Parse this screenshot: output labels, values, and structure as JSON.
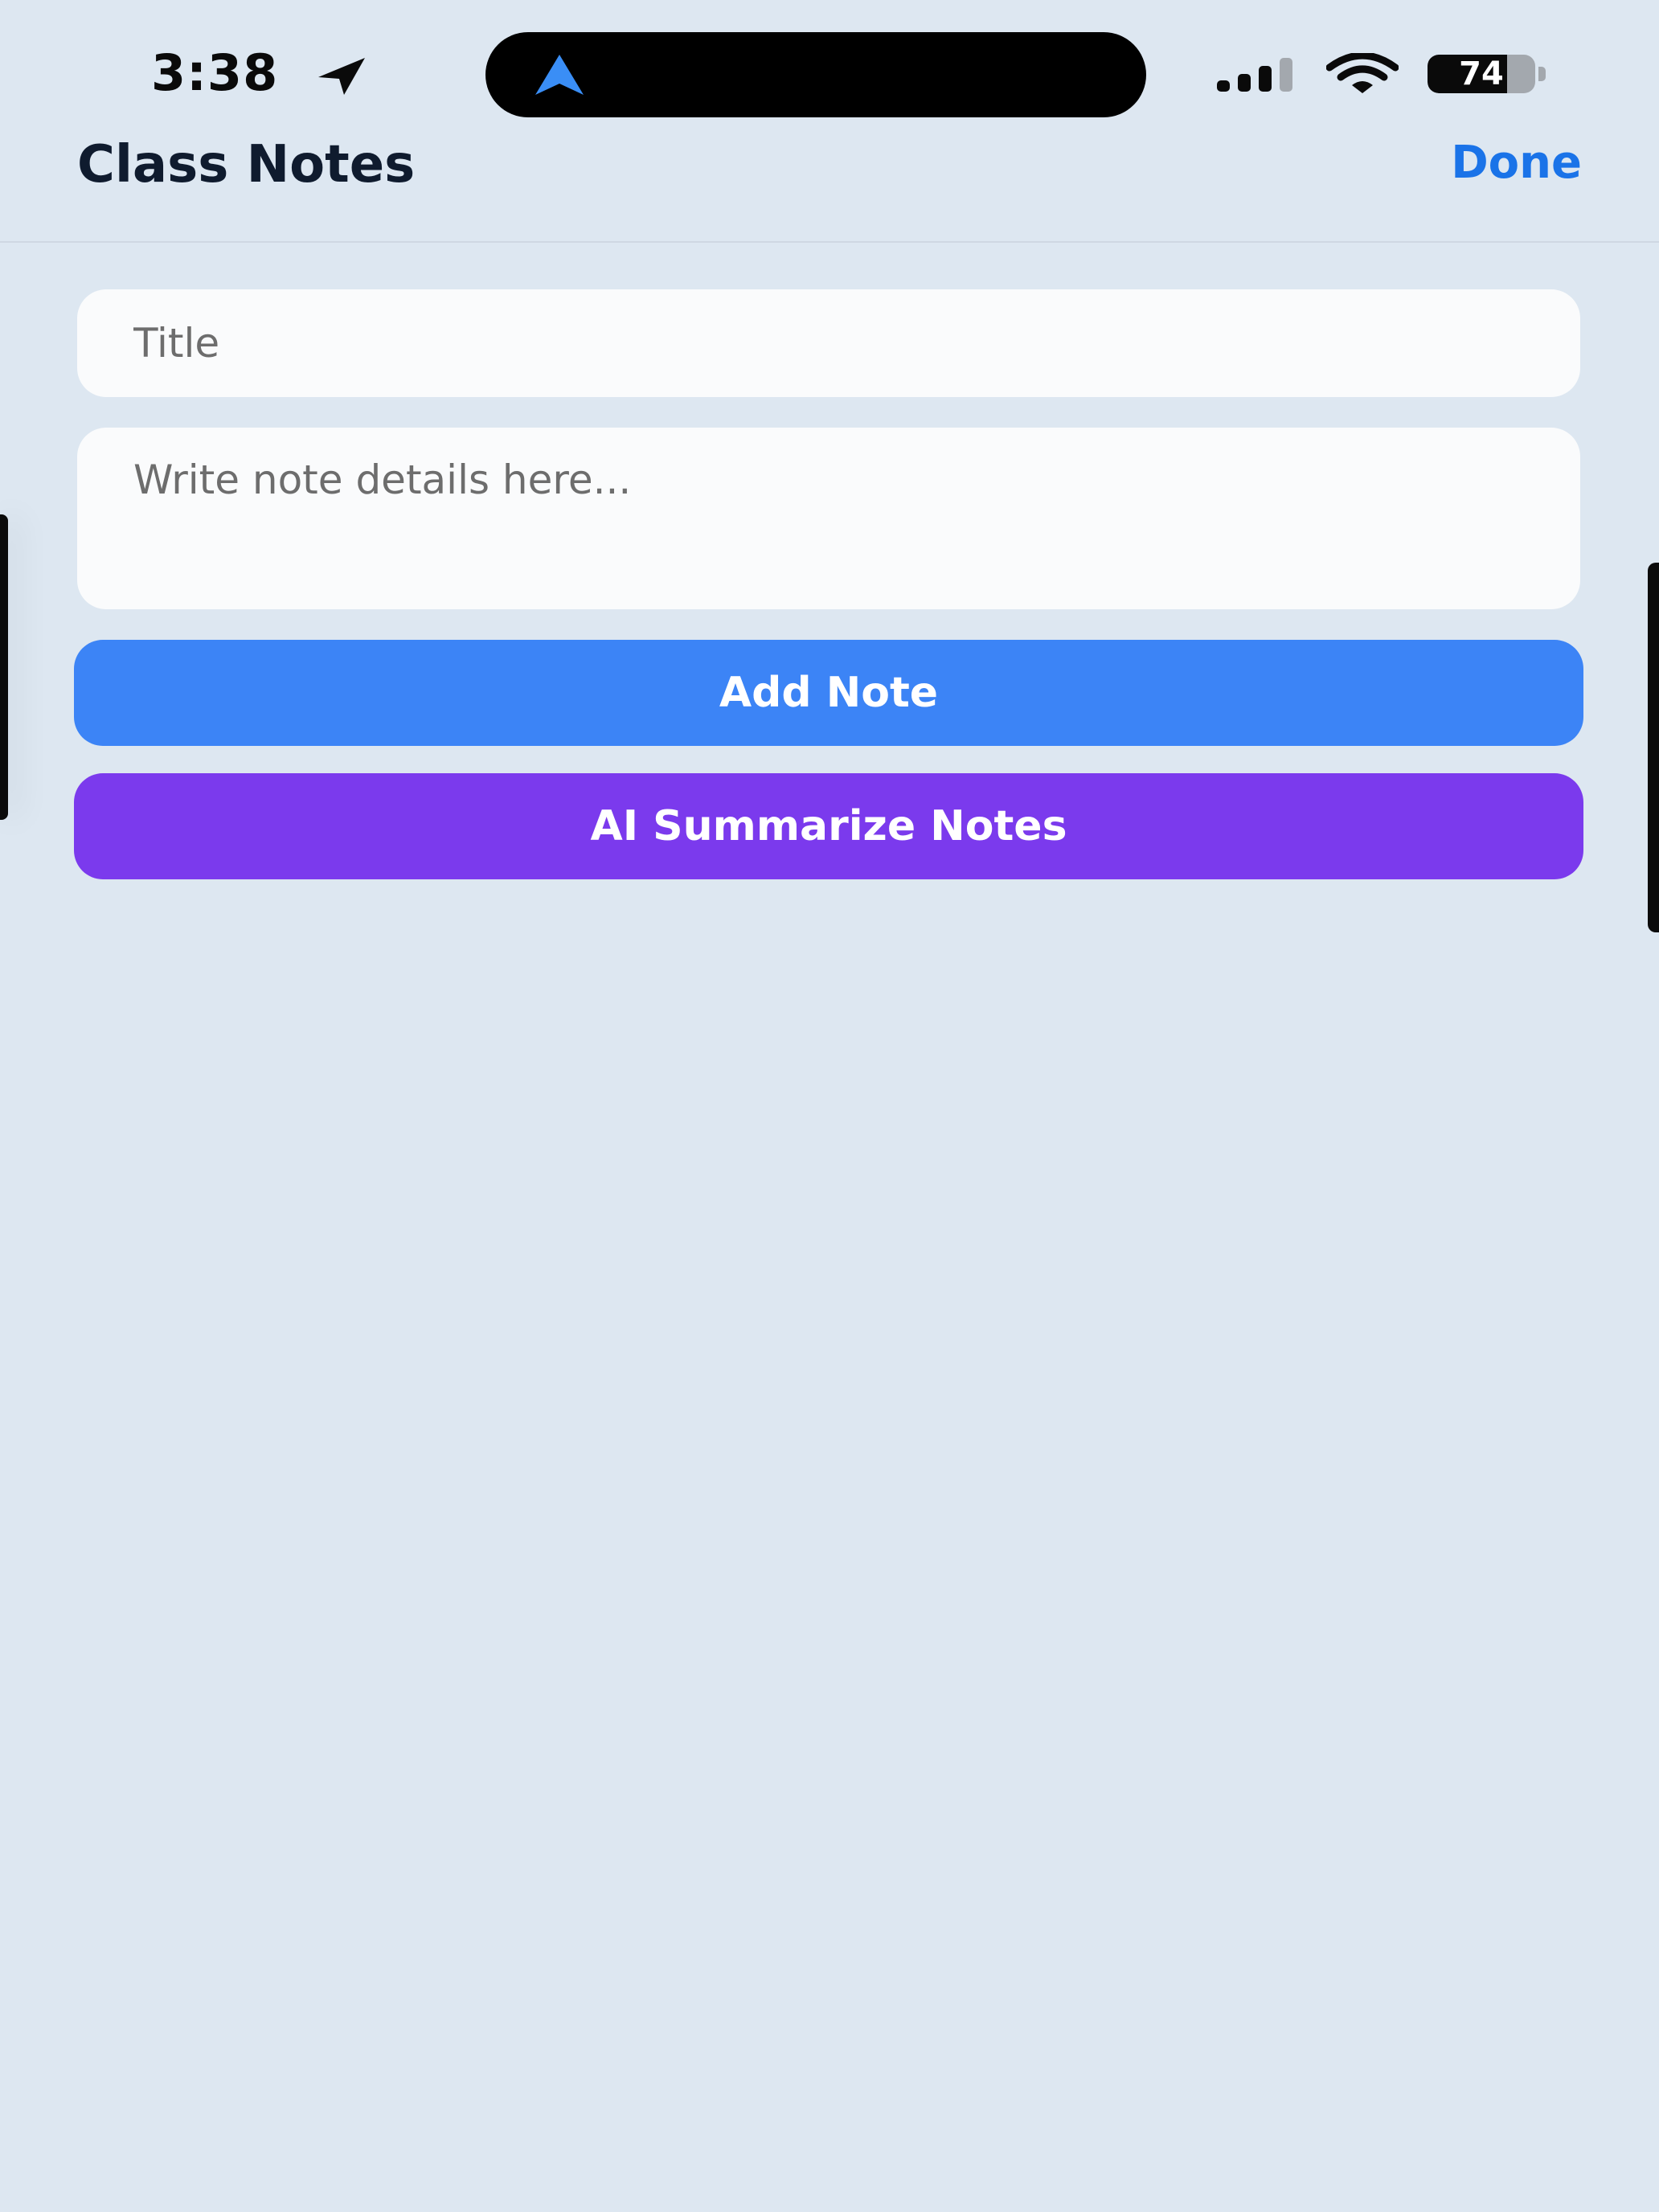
{
  "status_bar": {
    "time": "3:38",
    "battery_level": "74",
    "battery_fraction": 0.74,
    "icons": [
      "location-arrow-icon",
      "navigation-arrow-icon",
      "cellular-signal-icon",
      "wifi-icon",
      "battery-icon"
    ]
  },
  "header": {
    "title": "Class Notes",
    "done_label": "Done"
  },
  "form": {
    "title_placeholder": "Title",
    "title_value": "",
    "details_placeholder": "Write note details here...",
    "details_value": "",
    "add_label": "Add Note",
    "summarize_label": "AI Summarize Notes"
  },
  "colors": {
    "background": "#dde7f1",
    "accent_blue": "#3c84f6",
    "accent_purple": "#7b3aed",
    "done_blue": "#1a73e8",
    "nav_icon_blue": "#3a8ef6"
  }
}
